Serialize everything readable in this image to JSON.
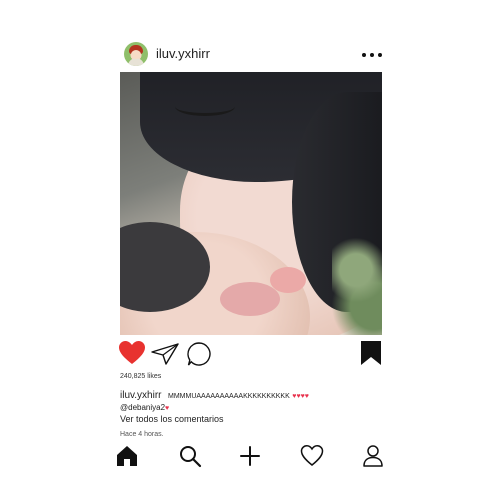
{
  "post": {
    "username": "iluv.yxhirr",
    "likes": "240,825 likes",
    "caption_user": "iluv.yxhirr",
    "caption_text": "MMMMUAAAAAAAAAAKKKKKKKKKK",
    "caption_hearts": "♥♥♥♥",
    "mention": "@debaniya2",
    "mention_heart": "♥",
    "view_comments": "Ver todos los comentarios",
    "timestamp": "Hace 4 horas."
  },
  "icons": {
    "more": "more-horizontal-icon",
    "like": "heart-filled-icon",
    "share": "paper-plane-icon",
    "comment": "comment-bubble-icon",
    "save": "bookmark-filled-icon",
    "nav": [
      "home-icon",
      "search-icon",
      "plus-icon",
      "heart-outline-icon",
      "profile-icon"
    ]
  },
  "colors": {
    "like_red": "#e8322f",
    "text": "#1a1a1a"
  }
}
